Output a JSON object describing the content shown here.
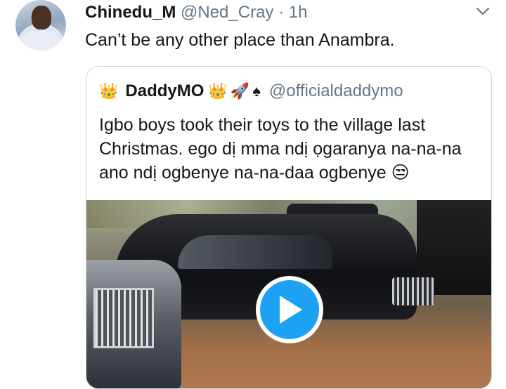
{
  "tweet": {
    "display_name": "Chinedu_M",
    "handle": "@Ned_Cray",
    "separator": "·",
    "time": "1h",
    "text": "Can’t be any other place than Anambra."
  },
  "quoted_tweet": {
    "crown_left": "👑",
    "display_name": "DaddyMO",
    "crown_right": "👑",
    "emoji_rocket": "🚀",
    "emoji_spade": "♠",
    "handle": "@officialdaddymo",
    "text": "Igbo boys took their toys to the village last Christmas. ego dị mma ndị ọgaranya na-na-na ano ndị ogbenye na-na-daa ogbenye 😒",
    "media": {
      "type": "video",
      "icon": "play-icon"
    }
  },
  "icons": {
    "menu": "chevron-down-icon",
    "play": "play-icon"
  },
  "colors": {
    "accent": "#1da1f2",
    "secondary_text": "#657786",
    "border": "#ccd6dd"
  }
}
